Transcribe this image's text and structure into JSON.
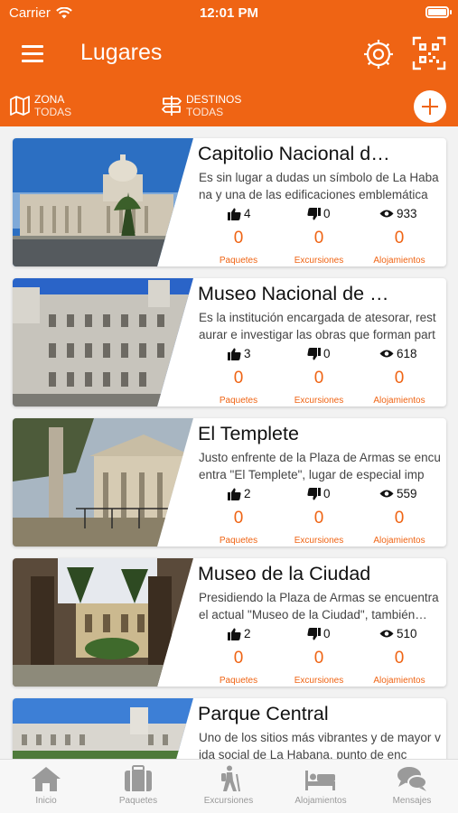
{
  "status": {
    "carrier": "Carrier",
    "time": "12:01 PM"
  },
  "header": {
    "title": "Lugares"
  },
  "filters": {
    "zona": {
      "label": "ZONA",
      "value": "TODAS"
    },
    "destinos": {
      "label": "DESTINOS",
      "value": "TODAS"
    }
  },
  "labels": {
    "paquetes": "Paquetes",
    "excursiones": "Excursiones",
    "alojamientos": "Alojamientos"
  },
  "places": [
    {
      "name": "Capitolio Nacional d…",
      "desc": "Es sin lugar a dudas un símbolo de La Habana y una de las edificaciones emblemática",
      "likes": "4",
      "dislikes": "0",
      "views": "933",
      "paquetes": "0",
      "excursiones": "0",
      "alojamientos": "0"
    },
    {
      "name": "Museo Nacional de …",
      "desc": "Es la institución encargada de atesorar, restaurar e investigar las obras que forman part",
      "likes": "3",
      "dislikes": "0",
      "views": "618",
      "paquetes": "0",
      "excursiones": "0",
      "alojamientos": "0"
    },
    {
      "name": "El Templete",
      "desc": "Justo enfrente de la Plaza de Armas se encuentra \"El Templete\", lugar de especial imp",
      "likes": "2",
      "dislikes": "0",
      "views": "559",
      "paquetes": "0",
      "excursiones": "0",
      "alojamientos": "0"
    },
    {
      "name": "Museo de la Ciudad",
      "desc": "Presidiendo la Plaza de Armas se encuentra el actual \"Museo de la Ciudad\", también…",
      "likes": "2",
      "dislikes": "0",
      "views": "510",
      "paquetes": "0",
      "excursiones": "0",
      "alojamientos": "0"
    },
    {
      "name": "Parque Central",
      "desc": "Uno de los sitios más vibrantes y de mayor vida social de La Habana, punto de enc",
      "likes": "",
      "dislikes": "",
      "views": "",
      "paquetes": "",
      "excursiones": "",
      "alojamientos": ""
    }
  ],
  "tabs": [
    {
      "label": "Inicio",
      "icon": "home-icon"
    },
    {
      "label": "Paquetes",
      "icon": "suitcase-icon"
    },
    {
      "label": "Excursiones",
      "icon": "hiker-icon"
    },
    {
      "label": "Alojamientos",
      "icon": "bed-icon"
    },
    {
      "label": "Mensajes",
      "icon": "chat-icon"
    }
  ],
  "colors": {
    "accent": "#ef6414",
    "tab_inactive": "#999999"
  }
}
